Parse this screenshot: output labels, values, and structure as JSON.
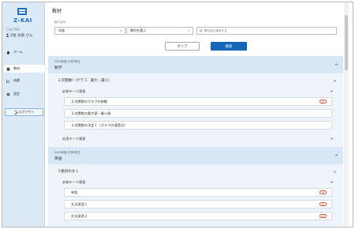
{
  "app": {
    "logo_text": "Z-KAI",
    "welcome_label": "こんにちは",
    "user_name": "Z会 太郎 さん"
  },
  "sidebar": {
    "items": [
      {
        "label": "ホーム",
        "icon": "home-icon"
      },
      {
        "label": "教材",
        "icon": "book-icon",
        "active": true
      },
      {
        "label": "成績",
        "icon": "chart-icon"
      },
      {
        "label": "設定",
        "icon": "gear-icon"
      }
    ],
    "logout_label": "ログアウト"
  },
  "page": {
    "title": "教材"
  },
  "filter": {
    "label": "絞り込み",
    "year_value": "年度",
    "subject_value": "教科を選ぶ",
    "search_placeholder": "教材名を検索する",
    "clear_label": "クリア",
    "search_label": "検索"
  },
  "subjects": [
    {
      "meta": "2020年度_中学3年生",
      "name": "数学",
      "unit": "２次関数Ⅰ（グラフ、最大・最小）",
      "group": "必修テーマ演習",
      "items": [
        {
          "label": "２次関数のグラフの移動",
          "badge": "未"
        },
        {
          "label": "２次関数の最大値・最小値",
          "badge": ""
        },
        {
          "label": "２次関数の決定１（グラフの通過点）",
          "badge": ""
        }
      ],
      "extra_group": "応用テーマ演習"
    },
    {
      "meta": "2020年度_中学3年生",
      "name": "英語",
      "unit": "Ｓ動詞の文１",
      "group": "必修テーマ演習",
      "items": [
        {
          "label": "単語",
          "badge": "未"
        },
        {
          "label": "文法演習１",
          "badge": "未"
        },
        {
          "label": "文法演習２",
          "badge": "未"
        }
      ]
    }
  ],
  "colors": {
    "accent": "#1566b8",
    "sidebar_bg": "#dce9f7",
    "header_bg": "#d7e7f6",
    "badge": "#d9553a"
  }
}
